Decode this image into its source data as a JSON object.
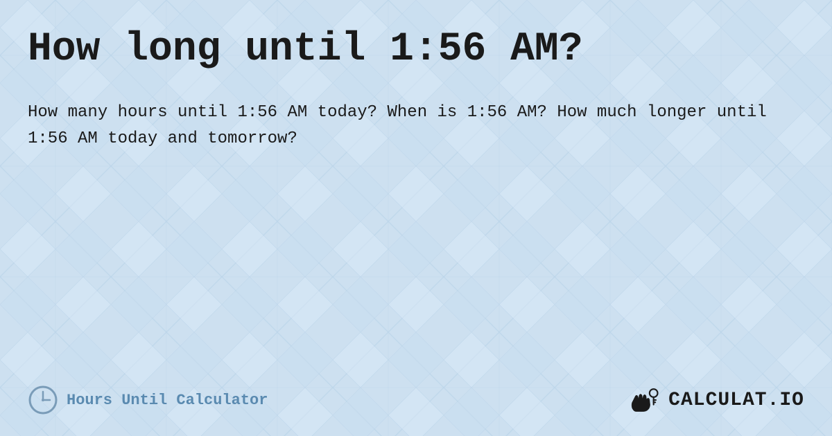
{
  "page": {
    "title": "How long until 1:56 AM?",
    "description": "How many hours until 1:56 AM today? When is 1:56 AM? How much longer until 1:56 AM today and tomorrow?",
    "background_color": "#c8dff0",
    "pattern_color_light": "#d6e8f5",
    "pattern_color_dark": "#b8d0e8"
  },
  "footer": {
    "label": "Hours Until Calculator",
    "brand": "CALCULAT.IO",
    "clock_icon": "clock-icon",
    "brand_icon": "calculator-hand-icon"
  }
}
